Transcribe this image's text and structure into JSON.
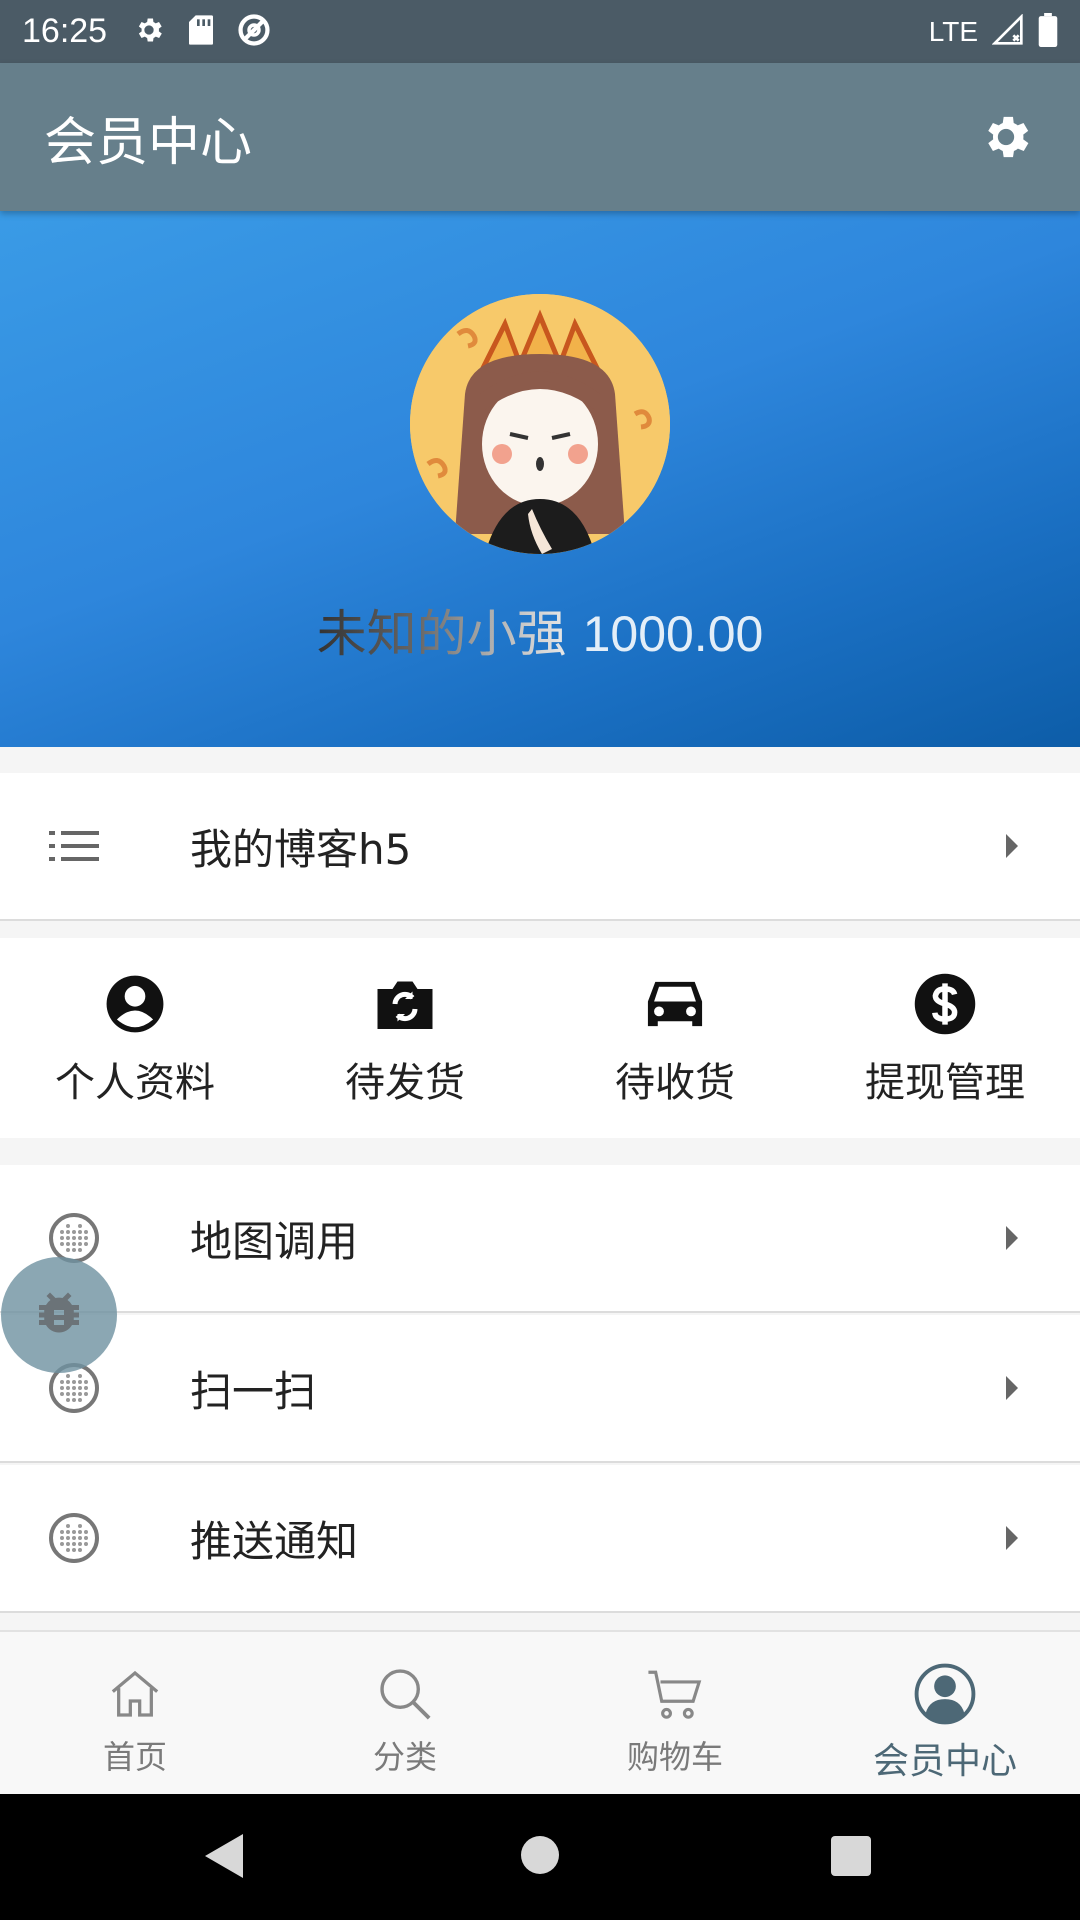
{
  "status_bar": {
    "time": "16:25",
    "network": "LTE",
    "icons": [
      "gear-icon",
      "sd-card-icon",
      "do-not-disturb-icon",
      "signal-icon",
      "battery-icon"
    ]
  },
  "app_bar": {
    "title": "会员中心",
    "settings_icon": "gear-icon"
  },
  "profile": {
    "name": "未知的小强",
    "balance": "1000.00"
  },
  "blog_row": {
    "label": "我的博客h5",
    "icon": "list-icon"
  },
  "quick_actions": [
    {
      "label": "个人资料",
      "icon": "account-circle-icon"
    },
    {
      "label": "待发货",
      "icon": "camera-switch-icon"
    },
    {
      "label": "待收货",
      "icon": "car-icon"
    },
    {
      "label": "提现管理",
      "icon": "dollar-circle-icon"
    }
  ],
  "menu": [
    {
      "label": "地图调用",
      "icon": "dots-circle-icon"
    },
    {
      "label": "扫一扫",
      "icon": "dots-circle-icon"
    },
    {
      "label": "推送通知",
      "icon": "dots-circle-icon"
    }
  ],
  "tabs": [
    {
      "label": "首页",
      "icon": "home-icon",
      "active": false
    },
    {
      "label": "分类",
      "icon": "search-icon",
      "active": false
    },
    {
      "label": "购物车",
      "icon": "cart-icon",
      "active": false
    },
    {
      "label": "会员中心",
      "icon": "user-icon",
      "active": true
    }
  ],
  "colors": {
    "status_bar": "#4b5b66",
    "app_bar": "#667f8b",
    "header_blue": "#2e86dc",
    "active_tab": "#4d6876"
  }
}
